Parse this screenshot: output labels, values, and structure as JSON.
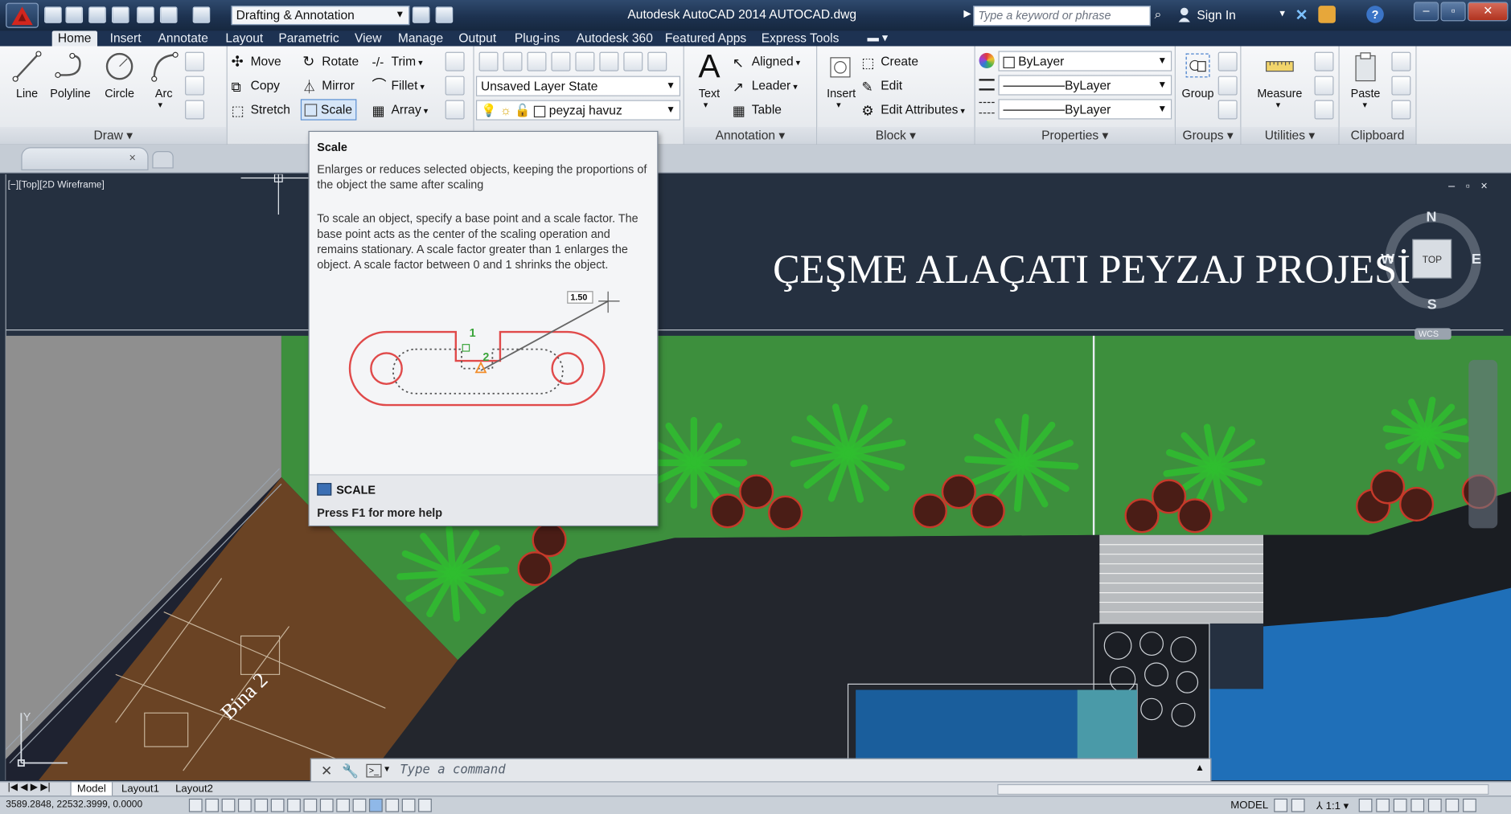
{
  "app": {
    "title": "Autodesk AutoCAD 2014    AUTOCAD.dwg",
    "workspace": "Drafting & Annotation",
    "search_placeholder": "Type a keyword or phrase",
    "sign_in": "Sign In",
    "question": "?"
  },
  "tabs": [
    "Home",
    "Insert",
    "Annotate",
    "Layout",
    "Parametric",
    "View",
    "Manage",
    "Output",
    "Plug-ins",
    "Autodesk 360",
    "Featured Apps",
    "Express Tools"
  ],
  "active_tab": "Home",
  "ribbon": {
    "draw": {
      "title": "Draw ▾",
      "line": "Line",
      "polyline": "Polyline",
      "circle": "Circle",
      "arc": "Arc"
    },
    "modify": {
      "move": "Move",
      "rotate": "Rotate",
      "trim": "Trim",
      "copy": "Copy",
      "mirror": "Mirror",
      "fillet": "Fillet",
      "stretch": "Stretch",
      "scale": "Scale",
      "array": "Array"
    },
    "layers": {
      "state": "Unsaved Layer State",
      "layer": "peyzaj havuz"
    },
    "annotation": {
      "title": "Annotation ▾",
      "text": "Text",
      "aligned": "Aligned",
      "leader": "Leader",
      "table": "Table"
    },
    "block": {
      "title": "Block ▾",
      "insert": "Insert",
      "create": "Create",
      "edit": "Edit",
      "edit_attributes": "Edit Attributes"
    },
    "properties": {
      "title": "Properties ▾",
      "color": "ByLayer",
      "linetype": "ByLayer",
      "lineweight": "ByLayer"
    },
    "groups": {
      "title": "Groups ▾",
      "group": "Group"
    },
    "utilities": {
      "title": "Utilities ▾",
      "measure": "Measure"
    },
    "clipboard": {
      "title": "Clipboard",
      "paste": "Paste"
    }
  },
  "viewport": {
    "label": "[−][Top][2D Wireframe]",
    "controls": "– ▫ ×",
    "project_title": "ÇEŞME ALAÇATI PEYZAJ PROJESİ",
    "building_label": "Bina 2",
    "compass": {
      "n": "N",
      "s": "S",
      "e": "E",
      "w": "W",
      "top": "TOP",
      "wcs": "WCS"
    },
    "ucs_y": "Y"
  },
  "tooltip": {
    "title": "Scale",
    "desc1": "Enlarges or reduces selected objects, keeping the proportions of the object the same after scaling",
    "desc2": "To scale an object, specify a base point and a scale factor. The base point acts as the center of the scaling operation and remains stationary. A scale factor greater than 1 enlarges the object. A scale factor between 0 and 1 shrinks the object.",
    "factor": "1.50",
    "pt1": "1",
    "pt2": "2",
    "command": "SCALE",
    "help": "Press F1 for more help"
  },
  "command_line": {
    "placeholder": "Type a command"
  },
  "layout_tabs": [
    "Model",
    "Layout1",
    "Layout2"
  ],
  "status": {
    "coords": "3589.2848, 22532.3999, 0.0000",
    "model": "MODEL",
    "scale": "1:1"
  },
  "colors": {
    "accent": "#1d3252",
    "tree_green": "#2fbf2f",
    "lawn": "#3e8f3e",
    "water": "#1f6fb8",
    "building": "#6a4324"
  }
}
